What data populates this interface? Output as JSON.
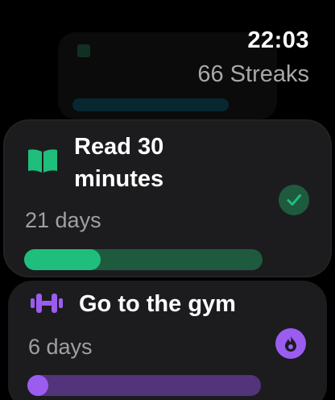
{
  "header": {
    "time": "22:03",
    "summary": "66 Streaks"
  },
  "habits": [
    {
      "title": "Read 30 minutes",
      "days": "21 days",
      "progress": 0.32,
      "status": "completed",
      "icon": "book-icon",
      "accent": "#1fbe7c",
      "track": "#1e5a3e"
    },
    {
      "title": "Go to the gym",
      "days": "6 days",
      "progress": 0.09,
      "status": "streak",
      "icon": "dumbbell-icon",
      "accent": "#9b5cf0",
      "track": "#52347a"
    }
  ],
  "colors": {
    "background": "#000000",
    "card": "#1c1c1e",
    "secondary_text": "#a0a0a0"
  }
}
